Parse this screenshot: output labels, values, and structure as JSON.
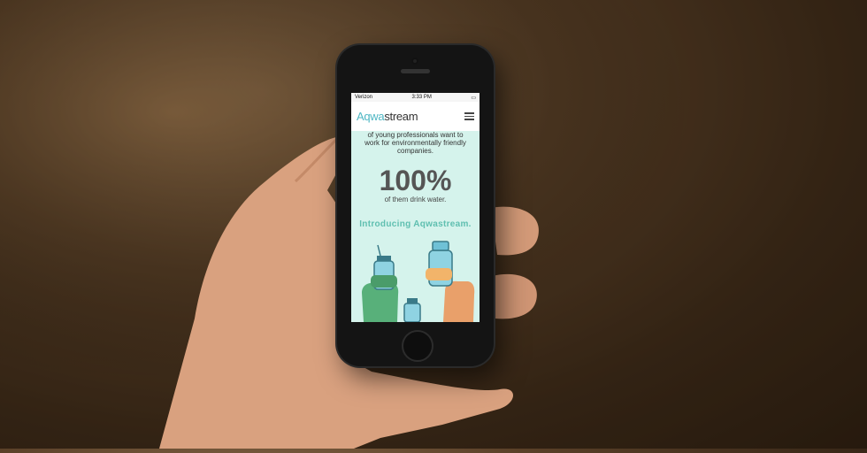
{
  "status": {
    "carrier": "Verizon",
    "time": "3:33 PM"
  },
  "header": {
    "logo_part1": "Aqwa",
    "logo_part2": "stream"
  },
  "content": {
    "line1": "of young professionals want to",
    "line2": "work for environmentally friendly",
    "line3": "companies.",
    "stat": "100%",
    "stat_caption": "of them drink water.",
    "intro": "Introducing Aqwastream."
  },
  "colors": {
    "brand": "#4fb7c4",
    "accent": "#5fbfb0",
    "screen_bg": "#d5f3ec"
  },
  "icons": {
    "menu": "hamburger-menu-icon"
  }
}
